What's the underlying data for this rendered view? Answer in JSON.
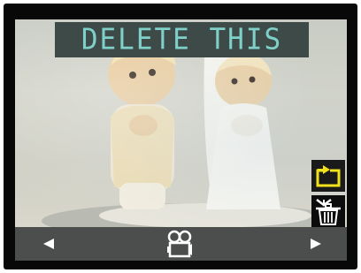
{
  "screen": {
    "banner_text": "DELETE THIS",
    "colors": {
      "bezel": "#080808",
      "banner_background": "#3d4a48",
      "banner_text": "#7fd0c9",
      "navbar_background": "#4b4e4d",
      "icon_white": "#ffffff",
      "icon_yellow": "#f1e11a"
    }
  },
  "photo": {
    "subject": "figurine-bride-and-groom"
  },
  "side_controls": [
    {
      "icon": "undo-return-icon",
      "color": "#f1e11a"
    },
    {
      "icon": "delete-trash-icon",
      "color": "#ffffff"
    }
  ],
  "navbar": {
    "left_icon": "left-arrow-icon",
    "center_icon": "video-camera-icon",
    "right_icon": "right-arrow-icon"
  }
}
